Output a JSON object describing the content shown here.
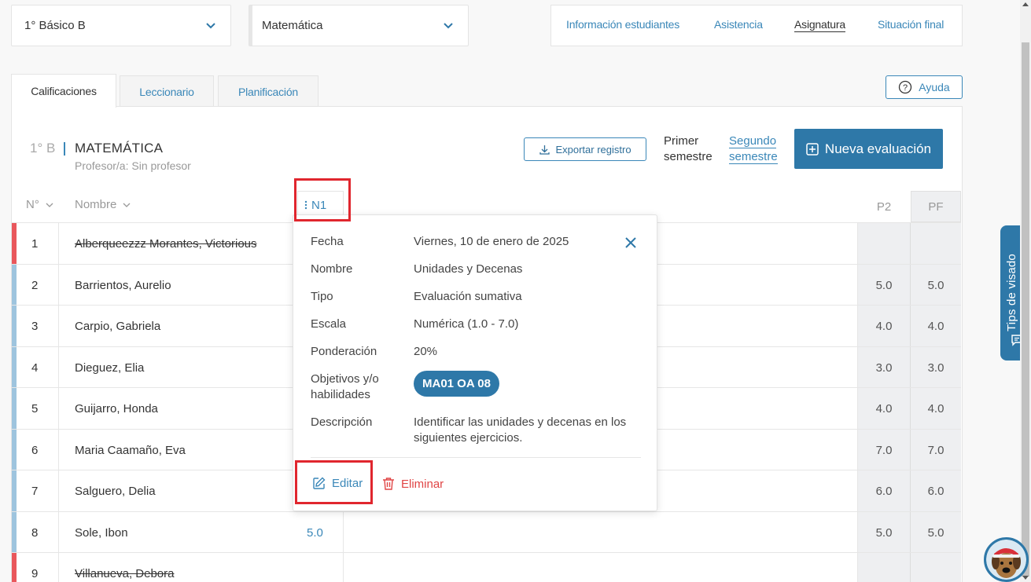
{
  "selectors": {
    "course": "1° Básico B",
    "subject": "Matemática"
  },
  "topnav": {
    "items": [
      "Información estudiantes",
      "Asistencia",
      "Asignatura",
      "Situación final"
    ],
    "active": "Asignatura"
  },
  "tabs": [
    "Calificaciones",
    "Leccionario",
    "Planificación"
  ],
  "help": "Ayuda",
  "header": {
    "course_code": "1° B",
    "subject": "MATEMÁTICA",
    "teacher": "Profesor/a: Sin profesor",
    "export": "Exportar registro",
    "semester1_line1": "Primer",
    "semester1_line2": "semestre",
    "semester2_line1": "Segundo",
    "semester2_line2": "semestre",
    "new_eval": "Nueva evaluación"
  },
  "table": {
    "col_num": "N°",
    "col_name": "Nombre",
    "col_n1": "N1",
    "col_p2": "P2",
    "col_pf": "PF",
    "rows": [
      {
        "n": "1",
        "name": "Alberqueezzz Morantes, Victorious",
        "n1": "",
        "p2": "",
        "pf": "",
        "withdrawn": true
      },
      {
        "n": "2",
        "name": "Barrientos, Aurelio",
        "n1": "",
        "p2": "5.0",
        "pf": "5.0",
        "withdrawn": false
      },
      {
        "n": "3",
        "name": "Carpio, Gabriela",
        "n1": "",
        "p2": "4.0",
        "pf": "4.0",
        "withdrawn": false
      },
      {
        "n": "4",
        "name": "Dieguez, Elia",
        "n1": "",
        "p2": "3.0",
        "pf": "3.0",
        "withdrawn": false
      },
      {
        "n": "5",
        "name": "Guijarro, Honda",
        "n1": "",
        "p2": "4.0",
        "pf": "4.0",
        "withdrawn": false
      },
      {
        "n": "6",
        "name": "Maria Caamaño, Eva",
        "n1": "",
        "p2": "7.0",
        "pf": "7.0",
        "withdrawn": false
      },
      {
        "n": "7",
        "name": "Salguero, Delia",
        "n1": "",
        "p2": "6.0",
        "pf": "6.0",
        "withdrawn": false
      },
      {
        "n": "8",
        "name": "Sole, Ibon",
        "n1": "5.0",
        "p2": "5.0",
        "pf": "5.0",
        "withdrawn": false
      },
      {
        "n": "9",
        "name": "Villanueva, Debora",
        "n1": "",
        "p2": "",
        "pf": "",
        "withdrawn": true
      }
    ]
  },
  "popover": {
    "fecha_label": "Fecha",
    "fecha": "Viernes, 10 de enero de 2025",
    "nombre_label": "Nombre",
    "nombre": "Unidades y Decenas",
    "tipo_label": "Tipo",
    "tipo": "Evaluación sumativa",
    "escala_label": "Escala",
    "escala": "Numérica (1.0 - 7.0)",
    "ponderacion_label": "Ponderación",
    "ponderacion": "20%",
    "objetivos_label_1": "Objetivos y/o",
    "objetivos_label_2": "habilidades",
    "objetivo_chip": "MA01 OA 08",
    "descripcion_label": "Descripción",
    "descripcion_1": "Identificar las unidades y decenas en los",
    "descripcion_2": "siguientes ejercicios.",
    "edit": "Editar",
    "delete": "Eliminar"
  },
  "tips": "Tips de visado",
  "colors": {
    "accent": "#2e78a8",
    "link": "#3a87b8",
    "withdrawn_flag": "#e9575c",
    "active_flag": "#9ec4de",
    "highlight": "#e0262e",
    "danger": "#e04545"
  }
}
